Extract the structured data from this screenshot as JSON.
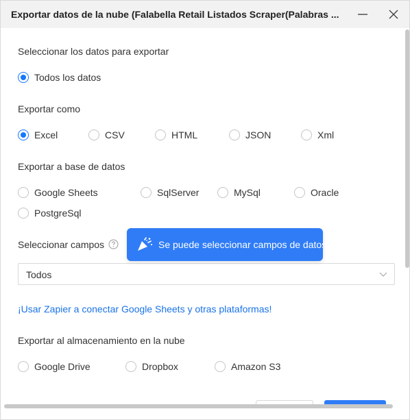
{
  "window": {
    "title": "Exportar datos de la nube (Falabella Retail Listados Scraper(Palabras ..."
  },
  "sections": {
    "select_data": {
      "title": "Seleccionar los datos para exportar",
      "options": [
        {
          "label": "Todos los datos",
          "checked": true
        }
      ]
    },
    "export_as": {
      "title": "Exportar como",
      "options": [
        {
          "label": "Excel",
          "checked": true
        },
        {
          "label": "CSV",
          "checked": false
        },
        {
          "label": "HTML",
          "checked": false
        },
        {
          "label": "JSON",
          "checked": false
        },
        {
          "label": "Xml",
          "checked": false
        }
      ]
    },
    "export_db": {
      "title": "Exportar a base de datos",
      "options": [
        {
          "label": "Google Sheets",
          "checked": false
        },
        {
          "label": "SqlServer",
          "checked": false
        },
        {
          "label": "MySql",
          "checked": false
        },
        {
          "label": "Oracle",
          "checked": false
        },
        {
          "label": "PostgreSql",
          "checked": false
        }
      ]
    },
    "select_fields": {
      "title": "Seleccionar campos",
      "tooltip": "Se puede seleccionar campos de datos",
      "select_value": "Todos"
    },
    "zapier_link": "¡Usar Zapier a conectar Google Sheets y otras plataformas!",
    "cloud_storage": {
      "title": "Exportar al almacenamiento en la nube",
      "options": [
        {
          "label": "Google Drive",
          "checked": false
        },
        {
          "label": "Dropbox",
          "checked": false
        },
        {
          "label": "Amazon S3",
          "checked": false
        }
      ]
    }
  },
  "colors": {
    "accent": "#1677ff",
    "tooltip_bg": "#2f7cf6",
    "link": "#1a73e8",
    "titlebar_bg": "#f2f2f2"
  },
  "icons": {
    "minimize": "minimize-icon",
    "close": "close-icon",
    "help": "help-icon",
    "party": "party-popper-icon",
    "dropdown": "chevron-down-icon"
  }
}
